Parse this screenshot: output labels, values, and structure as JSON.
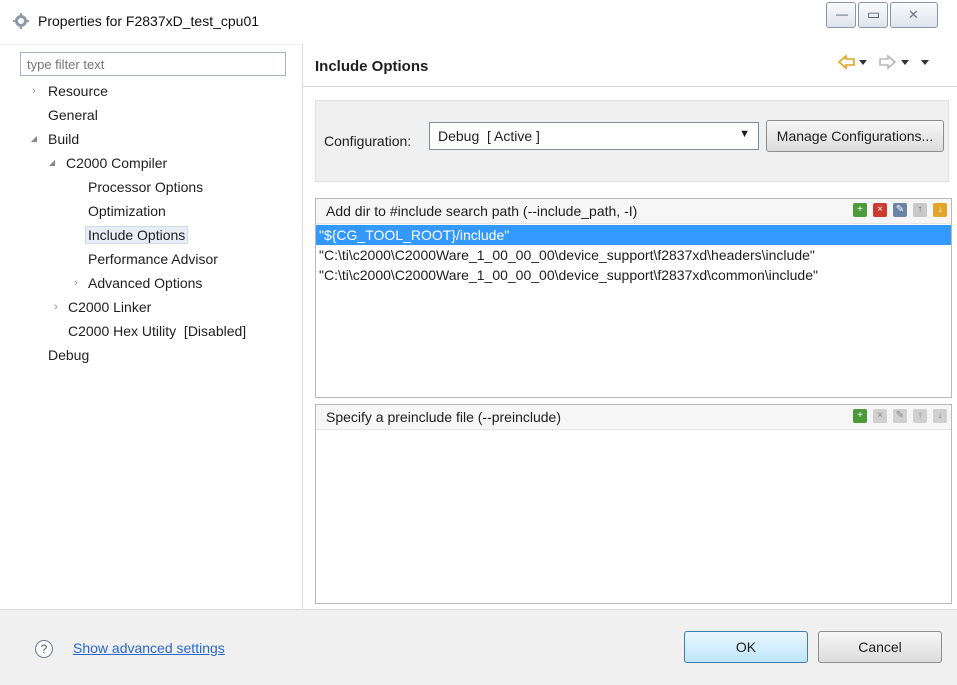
{
  "window": {
    "title": "Properties for F2837xD_test_cpu01",
    "minimize_glyph": "—",
    "maximize_glyph": "▭",
    "close_glyph": "✕"
  },
  "filter": {
    "placeholder": "type filter text",
    "value": ""
  },
  "tree": {
    "items": [
      {
        "label": "Resource",
        "twisty": "›"
      },
      {
        "label": "General",
        "twisty": ""
      },
      {
        "label": "Build",
        "twisty": "◢"
      },
      {
        "label": "C2000 Compiler",
        "twisty": "◢"
      },
      {
        "label": "Processor Options",
        "twisty": ""
      },
      {
        "label": "Optimization",
        "twisty": ""
      },
      {
        "label": "Include Options",
        "twisty": "",
        "selected": true
      },
      {
        "label": "Performance Advisor",
        "twisty": ""
      },
      {
        "label": "Advanced Options",
        "twisty": "›"
      },
      {
        "label": "C2000 Linker",
        "twisty": "›"
      },
      {
        "label": "C2000 Hex Utility  [Disabled]",
        "twisty": ""
      },
      {
        "label": "Debug",
        "twisty": ""
      }
    ]
  },
  "page": {
    "title": "Include Options",
    "nav_icons": [
      "back-icon",
      "forward-icon",
      "menu-icon"
    ]
  },
  "config": {
    "label": "Configuration:",
    "selected": "Debug  [ Active ]",
    "manage_button": "Manage Configurations..."
  },
  "include_paths": {
    "header": "Add dir to #include search path (--include_path, -I)",
    "items": [
      "\"${CG_TOOL_ROOT}/include\"",
      "\"C:\\ti\\c2000\\C2000Ware_1_00_00_00\\device_support\\f2837xd\\headers\\include\"",
      "\"C:\\ti\\c2000\\C2000Ware_1_00_00_00\\device_support\\f2837xd\\common\\include\""
    ],
    "selected_index": 0,
    "tools": [
      "add-icon",
      "delete-icon",
      "edit-icon",
      "move-up-icon",
      "move-down-icon"
    ]
  },
  "preinclude": {
    "header": "Specify a preinclude file (--preinclude)",
    "items": [],
    "tools": [
      "add-icon",
      "delete-icon",
      "edit-icon",
      "move-up-icon",
      "move-down-icon"
    ]
  },
  "footer": {
    "advanced_link": "Show advanced settings",
    "ok_label": "OK",
    "cancel_label": "Cancel"
  },
  "colors": {
    "selection": "#3399ff",
    "link": "#2a67c6",
    "nav_arrow": "#e3a21a"
  }
}
